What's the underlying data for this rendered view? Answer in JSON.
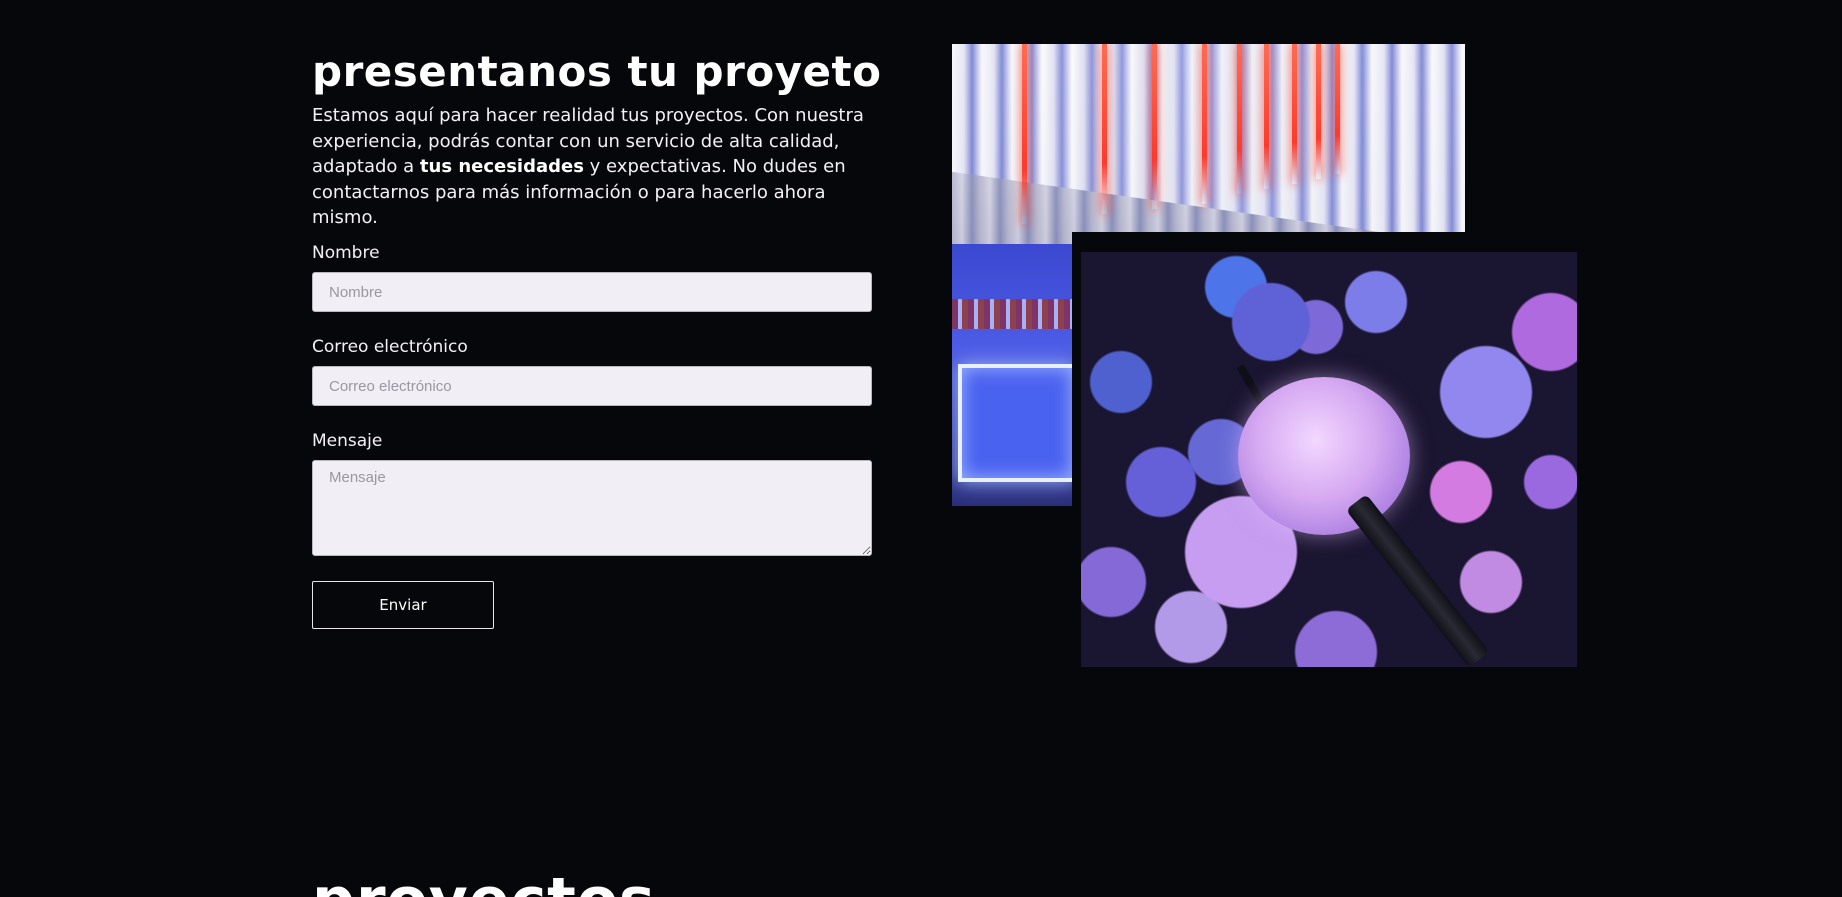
{
  "contact": {
    "title": "presentanos tu proyeto",
    "intro": {
      "before": "Estamos aquí para hacer realidad tus proyectos. Con nuestra experiencia, podrás contar con un servicio de alta calidad, adaptado a ",
      "highlight": "tus necesidades",
      "after": " y expectativas. No dudes en contactarnos para más información o para hacerlo ahora mismo."
    },
    "form": {
      "name_label": "Nombre",
      "name_placeholder": "Nombre",
      "email_label": "Correo electrónico",
      "email_placeholder": "Correo electrónico",
      "message_label": "Mensaje",
      "message_placeholder": "Mensaje",
      "submit_label": "Enviar"
    }
  },
  "next_section": {
    "title": "proyectos"
  },
  "colors": {
    "background": "#06070b",
    "input_background": "#f1eef5",
    "text": "#ffffff"
  }
}
